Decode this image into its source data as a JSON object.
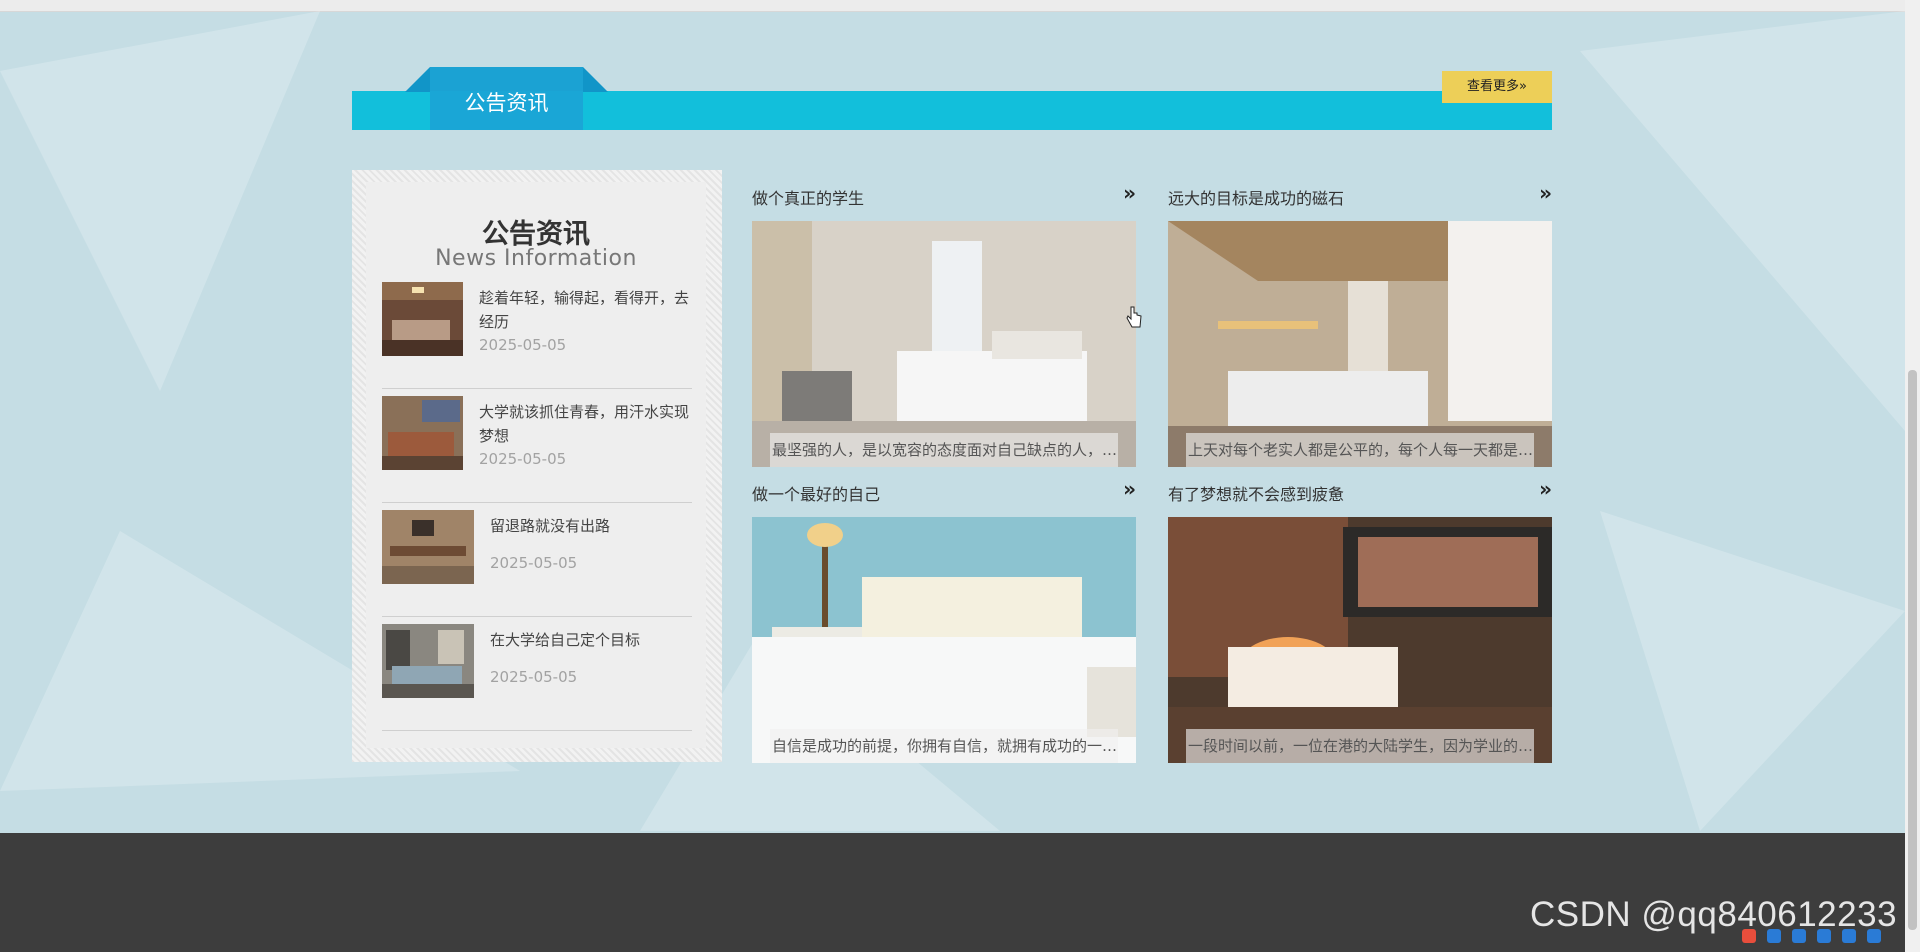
{
  "section": {
    "title": "公告资讯",
    "more_label": "查看更多»"
  },
  "card": {
    "title_cn": "公告资讯",
    "title_en": "News Information",
    "items": [
      {
        "title": "趁着年轻，输得起，看得开，去经历",
        "date": "2025-05-05"
      },
      {
        "title": "大学就该抓住青春，用汗水实现梦想",
        "date": "2025-05-05"
      },
      {
        "title": "留退路就没有出路",
        "date": "2025-05-05"
      },
      {
        "title": "在大学给自己定个目标",
        "date": "2025-05-05"
      }
    ]
  },
  "grid": [
    {
      "title": "做个真正的学生",
      "caption": "最坚强的人，是以宽容的态度面对自己缺点的人，而..."
    },
    {
      "title": "远大的目标是成功的磁石",
      "caption": "上天对每个老实人都是公平的，每个人每一天都是二..."
    },
    {
      "title": "做一个最好的自己",
      "caption": "自信是成功的前提，你拥有自信，就拥有成功的一半..."
    },
    {
      "title": "有了梦想就不会感到疲惫",
      "caption": "一段时间以前，一位在港的大陆学生，因为学业的压..."
    }
  ],
  "watermark": "CSDN @qq840612233",
  "colors": {
    "background": "#c5dde4",
    "section_bar": "#12bfdb",
    "section_tab": "#1aa6d6",
    "more_button": "#edcf58",
    "footer": "#3d3d3d"
  }
}
